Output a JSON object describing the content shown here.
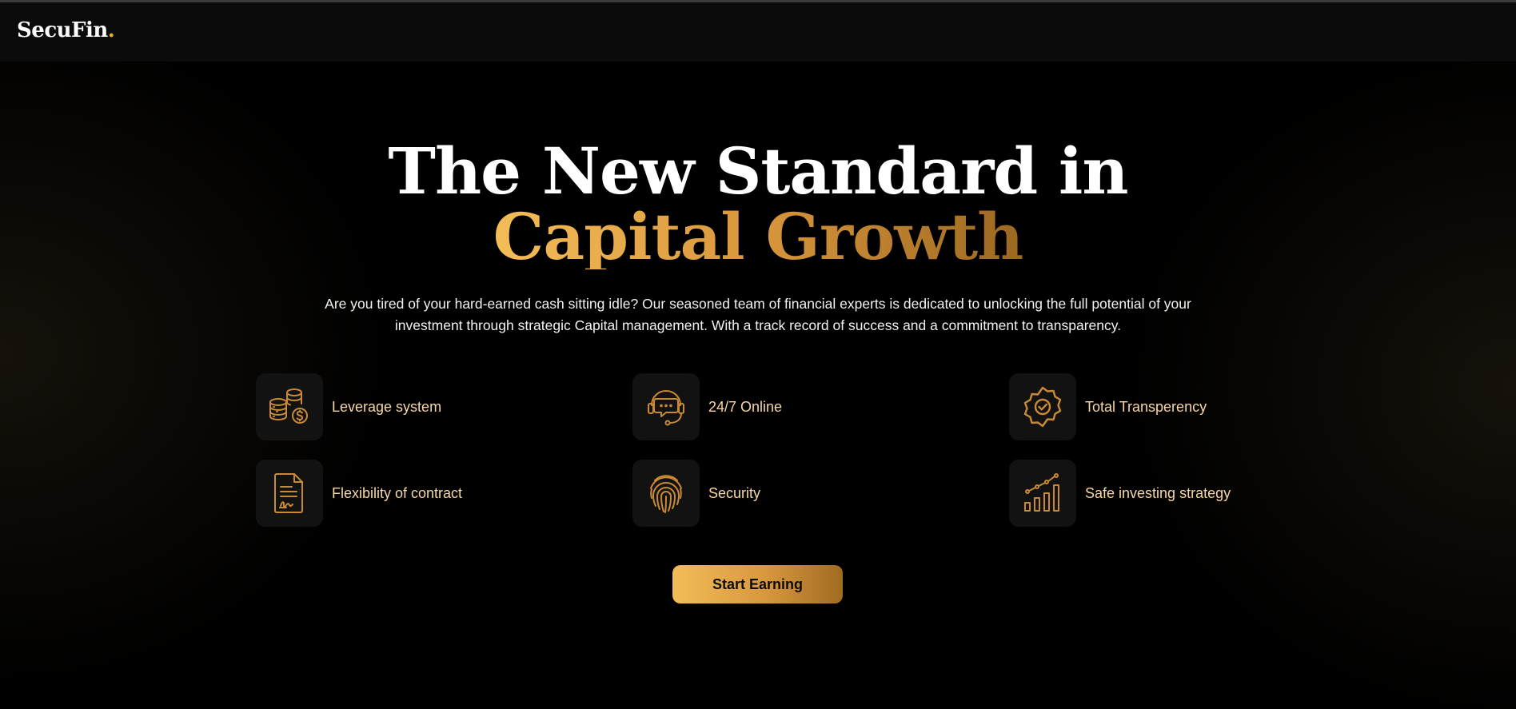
{
  "brand": {
    "name": "SecuFin",
    "dot": ".",
    "accent": "#e8a93c"
  },
  "hero": {
    "title_line1": "The New Standard in",
    "title_line2": "Capital Growth",
    "description": "Are you tired of your hard-earned cash sitting idle? Our seasoned team of financial experts is dedicated to unlocking the full potential of your investment through strategic Capital management. With a track record of success and a commitment to transparency.",
    "cta_label": "Start Earning"
  },
  "features": [
    {
      "label": "Leverage system",
      "icon": "coins-icon"
    },
    {
      "label": "24/7 Online",
      "icon": "headset-support-icon"
    },
    {
      "label": "Total Transperency",
      "icon": "verified-badge-icon"
    },
    {
      "label": "Flexibility of contract",
      "icon": "signed-contract-icon"
    },
    {
      "label": "Security",
      "icon": "fingerprint-icon"
    },
    {
      "label": "Safe investing strategy",
      "icon": "growth-chart-icon"
    }
  ],
  "colors": {
    "gold_start": "#f4bd58",
    "gold_end": "#9b6820",
    "icon_stroke": "#c98a36",
    "feature_text": "#f7d7a3"
  }
}
